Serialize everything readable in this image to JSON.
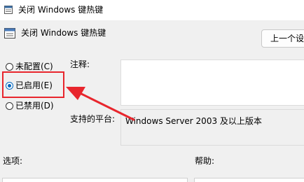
{
  "window": {
    "title": "关闭 Windows 键热键"
  },
  "header": {
    "title": "关闭 Windows 键热键",
    "prev_button": "上一个设置"
  },
  "state_options": [
    {
      "label": "未配置(C)",
      "selected": false
    },
    {
      "label": "已启用(E)",
      "selected": true
    },
    {
      "label": "已禁用(D)",
      "selected": false
    }
  ],
  "comment": {
    "label": "注释:",
    "value": ""
  },
  "platform": {
    "label": "支持的平台:",
    "value": "Windows Server 2003 及以上版本"
  },
  "options": {
    "label": "选项:"
  },
  "help": {
    "label": "帮助:"
  },
  "annotation": {
    "color": "#e8262d"
  },
  "colors": {
    "accent": "#0067c0",
    "background": "#f0f0f0"
  }
}
